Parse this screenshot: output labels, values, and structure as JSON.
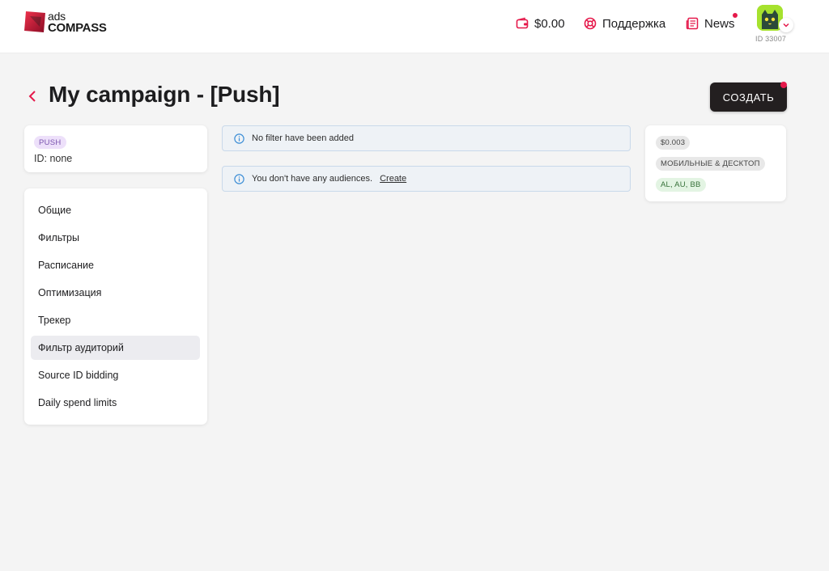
{
  "header": {
    "logo_small": "ads",
    "logo_big": "COMPASS",
    "balance": "$0.00",
    "support": "Поддержка",
    "news": "News",
    "account_id": "ID 33007",
    "icons": {
      "balance": "wallet-icon",
      "support": "lifebuoy-icon",
      "news": "newspaper-icon"
    }
  },
  "page": {
    "title": "My campaign - [Push]",
    "create_button": "СОЗДАТЬ"
  },
  "campaign": {
    "type_badge": "PUSH",
    "id_label": "ID: none"
  },
  "nav": {
    "items": [
      {
        "label": "Общие"
      },
      {
        "label": "Фильтры"
      },
      {
        "label": "Расписание"
      },
      {
        "label": "Оптимизация"
      },
      {
        "label": "Трекер"
      },
      {
        "label": "Фильтр аудиторий",
        "active": true
      },
      {
        "label": "Source ID bidding"
      },
      {
        "label": "Daily spend limits"
      }
    ]
  },
  "alerts": {
    "no_filter": "No filter have been added",
    "no_audiences": "You don't have any audiences.",
    "create_link": "Create"
  },
  "summary": {
    "price": "$0.003",
    "devices": "МОБИЛЬНЫЕ & ДЕСКТОП",
    "geo": "AL, AU, BB"
  },
  "colors": {
    "accent": "#e5194b",
    "dark_button": "#231f20",
    "info_blue": "#3d8ed6",
    "avatar_bg": "#a6e22e"
  }
}
